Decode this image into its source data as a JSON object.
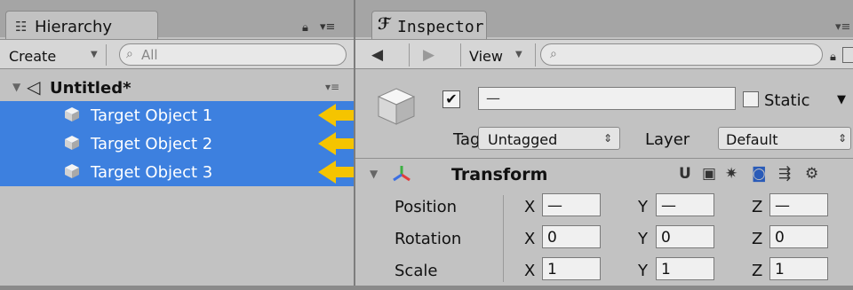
{
  "hierarchy": {
    "tab_label": "Hierarchy",
    "create_label": "Create",
    "search_placeholder": "All",
    "scene_name": "Untitled*",
    "objects": [
      {
        "label": "Target Object 1"
      },
      {
        "label": "Target Object 2"
      },
      {
        "label": "Target Object 3"
      }
    ]
  },
  "inspector": {
    "tab_label": "Inspector",
    "view_label": "View",
    "object_name": "—",
    "active_checked": true,
    "static_label": "Static",
    "tag_label": "Tag",
    "tag_value": "Untagged",
    "layer_label": "Layer",
    "layer_value": "Default",
    "transform": {
      "title": "Transform",
      "rows": [
        {
          "label": "Position",
          "x": "—",
          "y": "—",
          "z": "—"
        },
        {
          "label": "Rotation",
          "x": "0",
          "y": "0",
          "z": "0"
        },
        {
          "label": "Scale",
          "x": "1",
          "y": "1",
          "z": "1"
        }
      ],
      "axis_labels": [
        "X",
        "Y",
        "Z"
      ]
    }
  },
  "colors": {
    "selection": "#3d80df",
    "arrow": "#f5c400",
    "panel_bg": "#c2c2c2"
  }
}
